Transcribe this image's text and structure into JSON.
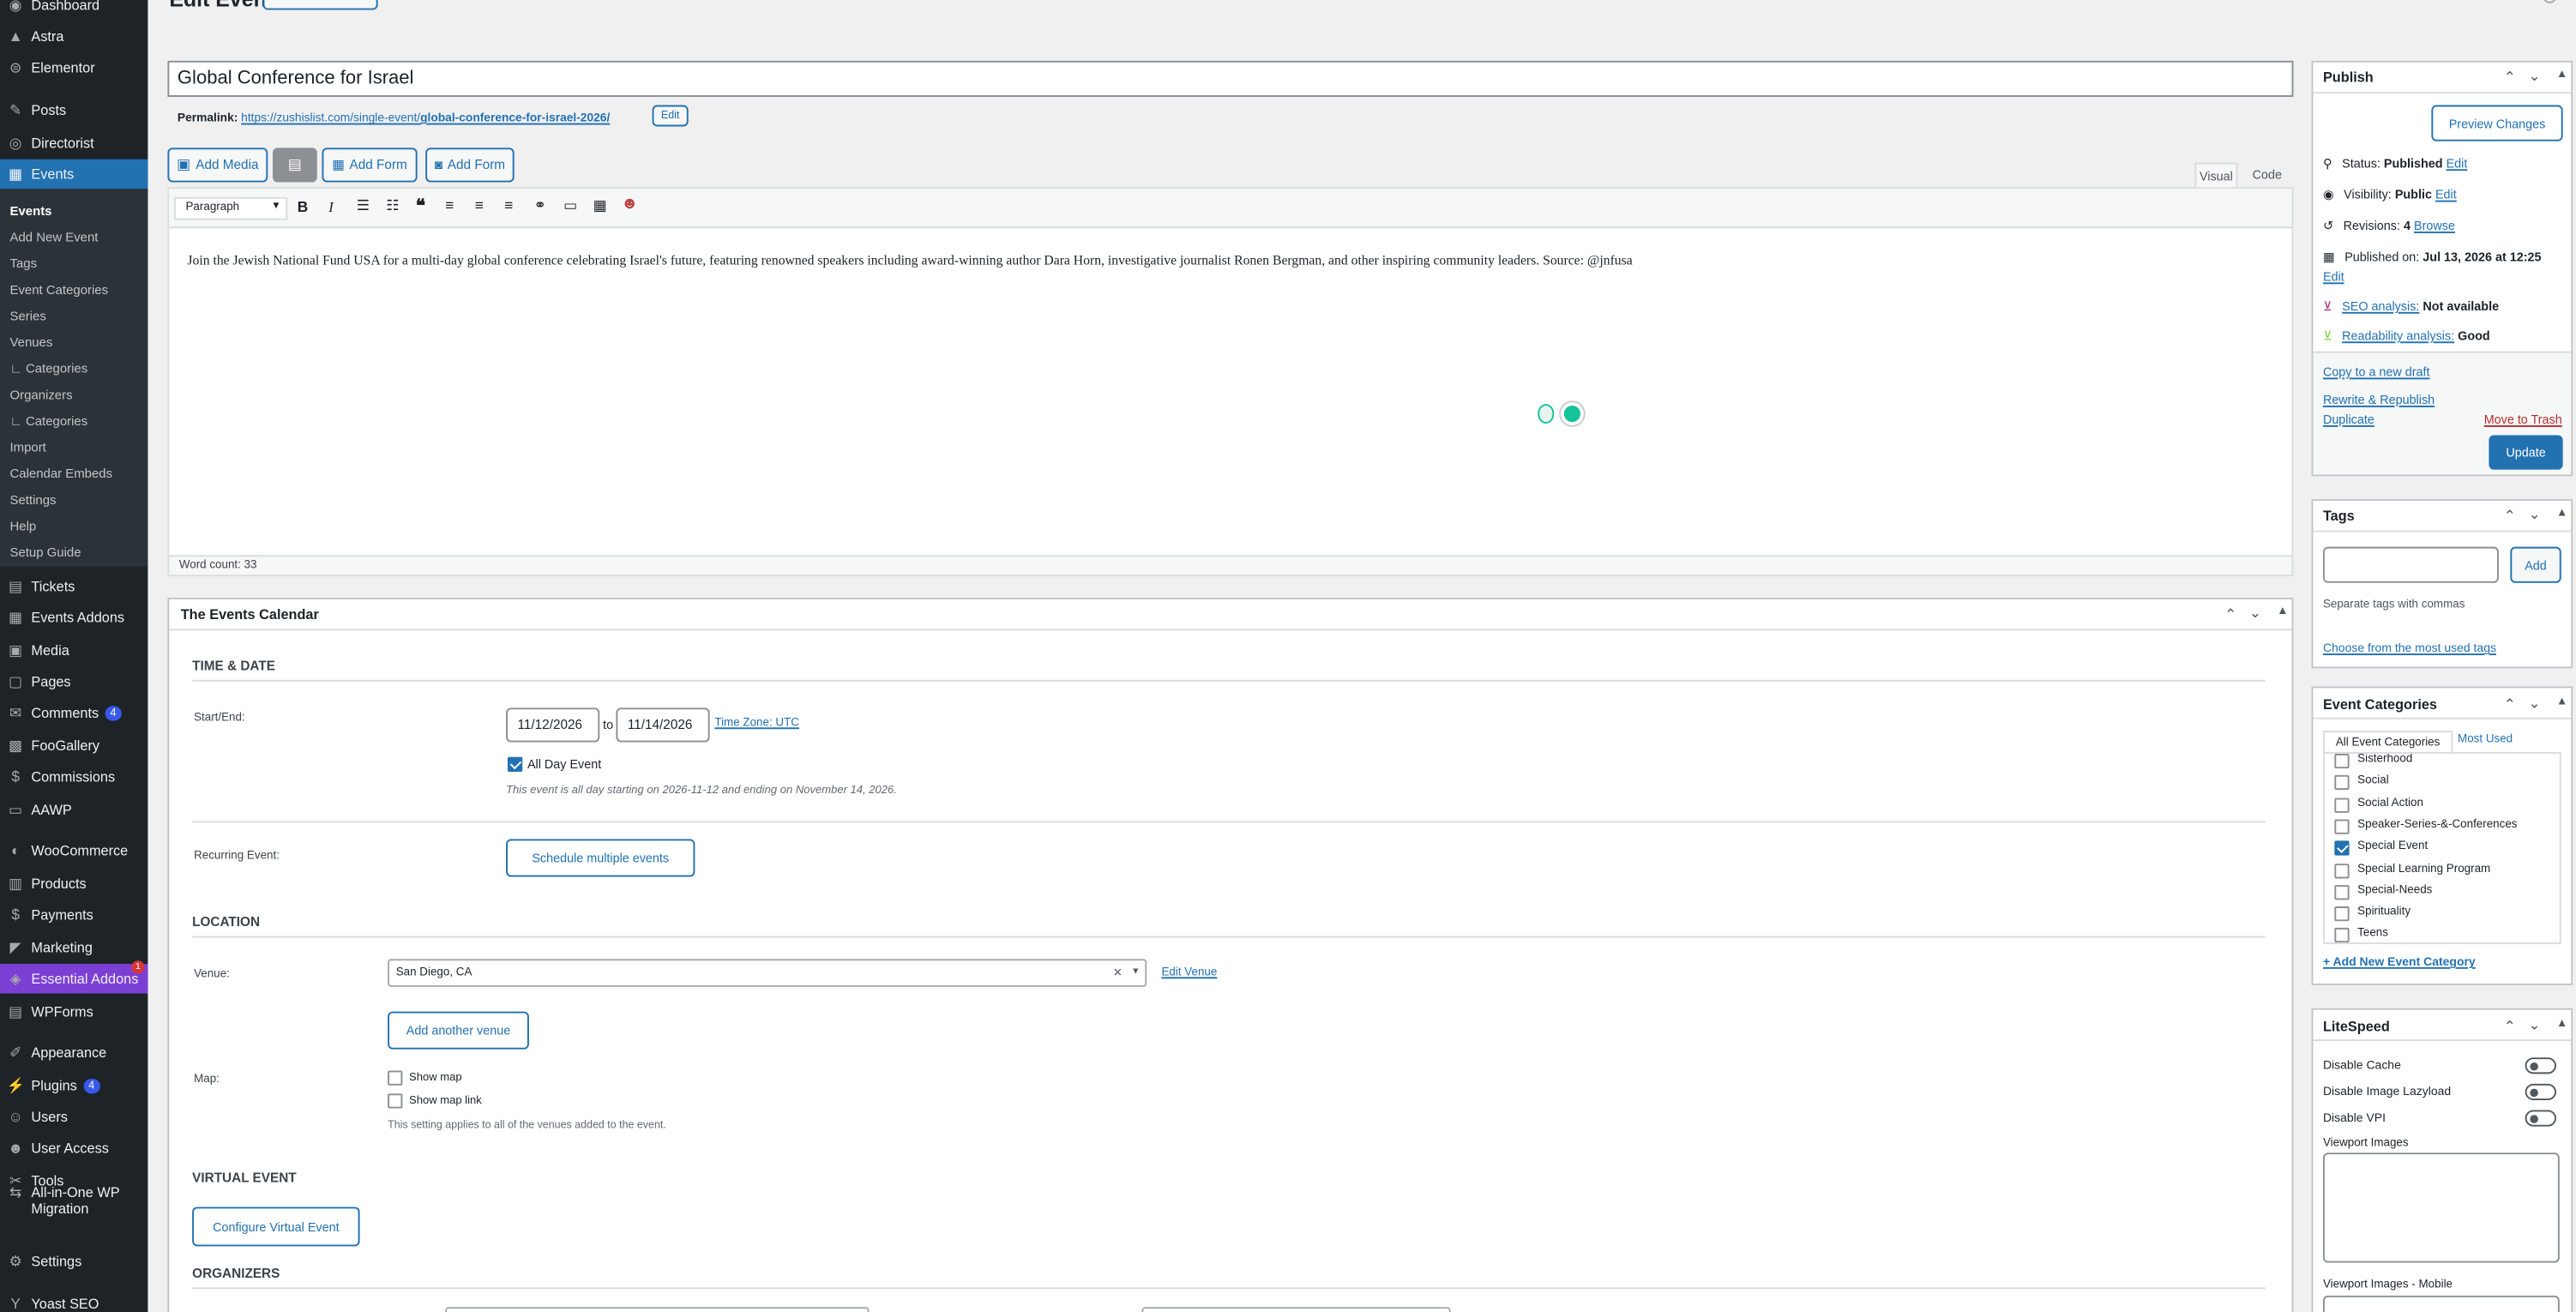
{
  "sidebar": {
    "items": [
      {
        "label": "Dashboard",
        "icon": "dashboard-icon",
        "glyph": "◉"
      },
      {
        "label": "Astra",
        "icon": "astra-icon",
        "glyph": "▲"
      },
      {
        "label": "Elementor",
        "icon": "elementor-icon",
        "glyph": "⊜"
      },
      {
        "label": "Posts",
        "icon": "pin-icon",
        "glyph": "✎"
      },
      {
        "label": "Directorist",
        "icon": "directorist-icon",
        "glyph": "◎"
      },
      {
        "label": "Events",
        "icon": "calendar-icon",
        "glyph": "▦"
      },
      {
        "label": "Tickets",
        "icon": "ticket-icon",
        "glyph": "▤"
      },
      {
        "label": "Events Addons",
        "icon": "calendar-addons-icon",
        "glyph": "▦"
      },
      {
        "label": "Media",
        "icon": "media-icon",
        "glyph": "▣"
      },
      {
        "label": "Pages",
        "icon": "pages-icon",
        "glyph": "▢"
      },
      {
        "label": "Comments",
        "icon": "comment-icon",
        "glyph": "✉",
        "badge": "4"
      },
      {
        "label": "FooGallery",
        "icon": "gallery-icon",
        "glyph": "▩"
      },
      {
        "label": "Commissions",
        "icon": "commissions-icon",
        "glyph": "$"
      },
      {
        "label": "AAWP",
        "icon": "cart-icon",
        "glyph": "▭"
      },
      {
        "label": "WooCommerce",
        "icon": "woocommerce-icon",
        "glyph": "◐"
      },
      {
        "label": "Products",
        "icon": "products-icon",
        "glyph": "▥"
      },
      {
        "label": "Payments",
        "icon": "payments-icon",
        "glyph": "$"
      },
      {
        "label": "Marketing",
        "icon": "megaphone-icon",
        "glyph": "◤"
      },
      {
        "label": "Essential Addons",
        "icon": "essential-addons-icon",
        "glyph": "◈",
        "dot": "1"
      },
      {
        "label": "WPForms",
        "icon": "wpforms-icon",
        "glyph": "▤"
      },
      {
        "label": "Appearance",
        "icon": "brush-icon",
        "glyph": "✐"
      },
      {
        "label": "Plugins",
        "icon": "plugin-icon",
        "glyph": "⚡",
        "badge": "4"
      },
      {
        "label": "Users",
        "icon": "user-icon",
        "glyph": "☺"
      },
      {
        "label": "User Access",
        "icon": "user-access-icon",
        "glyph": "☻"
      },
      {
        "label": "Tools",
        "icon": "wrench-icon",
        "glyph": "✂"
      },
      {
        "label": "All-in-One WP",
        "label2": "Migration",
        "icon": "migration-icon",
        "glyph": "⇆"
      },
      {
        "label": "Settings",
        "icon": "settings-icon",
        "glyph": "⚙"
      },
      {
        "label": "Yoast SEO",
        "icon": "yoast-icon",
        "glyph": "Y"
      }
    ],
    "submenu": [
      "Events",
      "Add New Event",
      "Tags",
      "Event Categories",
      "Series",
      "Venues",
      "Categories",
      "Organizers",
      "Categories",
      "Import",
      "Calendar Embeds",
      "Settings",
      "Help",
      "Setup Guide"
    ]
  },
  "header": {
    "title": "Edit Event"
  },
  "editor": {
    "post_title": "Global Conference for Israel",
    "permalink_label": "Permalink:",
    "permalink_base": "https://zushislist.com/single-event/",
    "permalink_slug": "global-conference-for-israel-2026/",
    "permalink_edit": "Edit",
    "add_media": "Add Media",
    "add_form_1": "Add Form",
    "add_form_2": "Add Form",
    "tab_visual": "Visual",
    "tab_code": "Code",
    "format_select": "Paragraph",
    "content": "Join the Jewish National Fund USA for a multi-day global conference celebrating Israel's future, featuring renowned speakers including award-winning author Dara Horn, investigative journalist Ronen Bergman, and other inspiring community leaders. Source: @jnfusa",
    "word_count": "Word count: 33"
  },
  "tec": {
    "title": "The Events Calendar",
    "time_date_heading": "TIME & DATE",
    "start_end_label": "Start/End:",
    "start_date": "11/12/2026",
    "to": "to",
    "end_date": "11/14/2026",
    "timezone_link": "Time Zone: UTC",
    "all_day_label": "All Day Event",
    "all_day_note": "This event is all day starting on 2026-11-12 and ending on November 14, 2026.",
    "recurring_label": "Recurring Event:",
    "schedule_button": "Schedule multiple events",
    "location_heading": "LOCATION",
    "venue_label": "Venue:",
    "venue_value": "San Diego, CA",
    "clear": "×",
    "edit_venue": "Edit Venue",
    "add_venue_button": "Add another venue",
    "map_label": "Map:",
    "show_map": "Show map",
    "show_map_link": "Show map link",
    "map_note": "This setting applies to all of the venues added to the event.",
    "virtual_heading": "VIRTUAL EVENT",
    "configure_virtual": "Configure Virtual Event",
    "organizers_heading": "ORGANIZERS"
  },
  "publish": {
    "title": "Publish",
    "preview": "Preview Changes",
    "status_label": "Status:",
    "status_value": "Published",
    "visibility_label": "Visibility:",
    "visibility_value": "Public",
    "revisions_label": "Revisions:",
    "revisions_value": "4",
    "browse": "Browse",
    "published_on_label": "Published on:",
    "published_on_value": "Jul 13, 2026 at 12:25",
    "edit": "Edit",
    "seo_label": "SEO analysis:",
    "seo_value": "Not available",
    "readability_label": "Readability analysis:",
    "readability_value": "Good",
    "copy_draft": "Copy to a new draft",
    "rewrite": "Rewrite & Republish",
    "duplicate": "Duplicate",
    "trash": "Move to Trash",
    "update": "Update"
  },
  "tags": {
    "title": "Tags",
    "add": "Add",
    "hint": "Separate tags with commas",
    "choose": "Choose from the most used tags"
  },
  "categories": {
    "title": "Event Categories",
    "tab_all": "All Event Categories",
    "tab_most": "Most Used",
    "items": [
      {
        "label": "Sisterhood",
        "checked": false
      },
      {
        "label": "Social",
        "checked": false
      },
      {
        "label": "Social Action",
        "checked": false
      },
      {
        "label": "Speaker-Series-&-Conferences",
        "checked": false
      },
      {
        "label": "Special Event",
        "checked": true
      },
      {
        "label": "Special Learning Program",
        "checked": false
      },
      {
        "label": "Special-Needs",
        "checked": false
      },
      {
        "label": "Spirituality",
        "checked": false
      },
      {
        "label": "Teens",
        "checked": false
      }
    ],
    "add_new": "+ Add New Event Category"
  },
  "litespeed": {
    "title": "LiteSpeed",
    "disable_cache": "Disable Cache",
    "disable_lazyload": "Disable Image Lazyload",
    "disable_vpi": "Disable VPI",
    "viewport_images": "Viewport Images",
    "viewport_images_mobile": "Viewport Images - Mobile"
  }
}
